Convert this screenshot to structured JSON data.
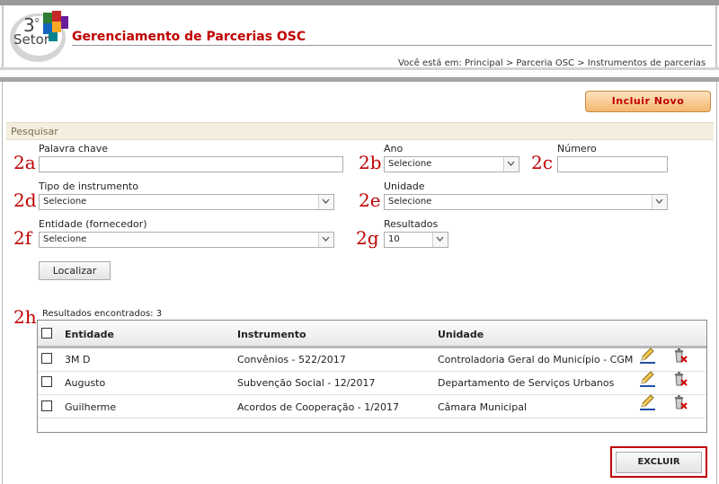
{
  "header": {
    "logo_text": "3º Setor",
    "app_title": "Gerenciamento de Parcerias OSC",
    "breadcrumb": "Você está em: Principal > Parceria OSC > Instrumentos de parcerias"
  },
  "actions": {
    "include_new": "Incluir Novo"
  },
  "search": {
    "section_title": "Pesquisar",
    "keyword": {
      "step": "2a",
      "label": "Palavra chave",
      "value": ""
    },
    "year": {
      "step": "2b",
      "label": "Ano",
      "value": "Selecione"
    },
    "number": {
      "step": "2c",
      "label": "Número",
      "value": ""
    },
    "instrument_type": {
      "step": "2d",
      "label": "Tipo de instrumento",
      "value": "Selecione"
    },
    "unit": {
      "step": "2e",
      "label": "Unidade",
      "value": "Selecione"
    },
    "entity": {
      "step": "2f",
      "label": "Entidade (fornecedor)",
      "value": "Selecione"
    },
    "results_per_page": {
      "step": "2g",
      "label": "Resultados",
      "value": "10"
    },
    "submit": "Localizar"
  },
  "results": {
    "step": "2h",
    "count_text": "Resultados encontrados: 3",
    "columns": {
      "entity": "Entidade",
      "instrument": "Instrumento",
      "unit": "Unidade"
    },
    "rows": [
      {
        "entity": "3M D",
        "instrument": "Convênios - 522/2017",
        "unit": "Controladoria Geral do Município - CGM"
      },
      {
        "entity": "Augusto",
        "instrument": "Subvenção Social - 12/2017",
        "unit": "Departamento de Serviços Urbanos"
      },
      {
        "entity": "Guilherme",
        "instrument": "Acordos de Cooperação - 1/2017",
        "unit": "Câmara Municipal"
      }
    ],
    "delete_button": "EXCLUIR"
  },
  "colors": {
    "accent_red": "#c00000",
    "orange_button": "#f3b771",
    "section_bar": "#f4eedf"
  },
  "icons": {
    "edit": "pencil-edit-icon",
    "delete": "trash-delete-icon",
    "dropdown": "chevron-down-icon"
  }
}
